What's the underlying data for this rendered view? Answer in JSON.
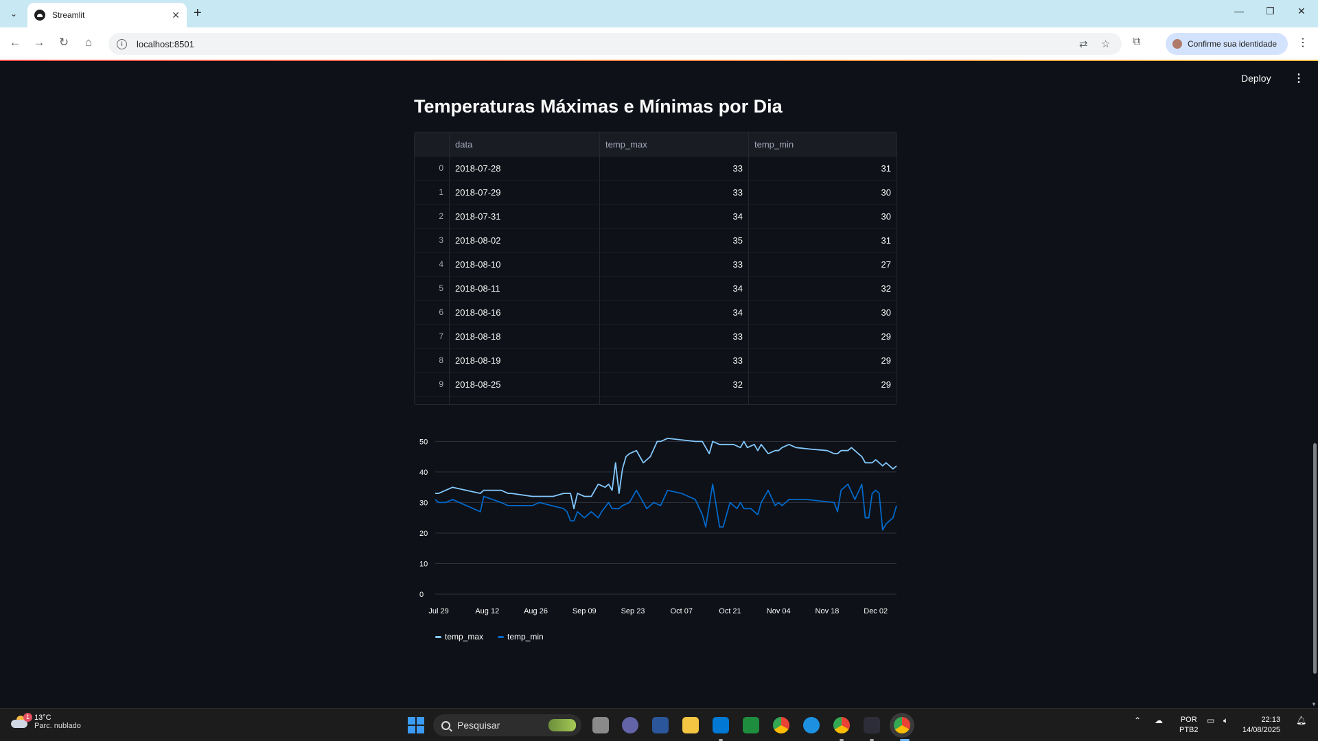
{
  "browser": {
    "tab_title": "Streamlit",
    "url": "localhost:8501",
    "profile_label": "Confirme sua identidade"
  },
  "app": {
    "deploy_label": "Deploy",
    "title": "Temperaturas Máximas e Mínimas por Dia"
  },
  "table": {
    "columns": [
      "data",
      "temp_max",
      "temp_min"
    ],
    "rows": [
      [
        "0",
        "2018-07-28",
        "33",
        "31"
      ],
      [
        "1",
        "2018-07-29",
        "33",
        "30"
      ],
      [
        "2",
        "2018-07-31",
        "34",
        "30"
      ],
      [
        "3",
        "2018-08-02",
        "35",
        "31"
      ],
      [
        "4",
        "2018-08-10",
        "33",
        "27"
      ],
      [
        "5",
        "2018-08-11",
        "34",
        "32"
      ],
      [
        "6",
        "2018-08-16",
        "34",
        "30"
      ],
      [
        "7",
        "2018-08-18",
        "33",
        "29"
      ],
      [
        "8",
        "2018-08-19",
        "33",
        "29"
      ],
      [
        "9",
        "2018-08-25",
        "32",
        "29"
      ]
    ]
  },
  "chart_data": {
    "type": "line",
    "title": "",
    "xlabel": "",
    "ylabel": "",
    "x_start": "2018-07-28",
    "x_end": "2018-12-08",
    "ylim": [
      0,
      53
    ],
    "y_ticks": [
      "0",
      "10",
      "20",
      "30",
      "40",
      "50"
    ],
    "x_ticks": [
      {
        "label": "Jul 29",
        "date": "2018-07-29"
      },
      {
        "label": "Aug 12",
        "date": "2018-08-12"
      },
      {
        "label": "Aug 26",
        "date": "2018-08-26"
      },
      {
        "label": "Sep 09",
        "date": "2018-09-09"
      },
      {
        "label": "Sep 23",
        "date": "2018-09-23"
      },
      {
        "label": "Oct 07",
        "date": "2018-10-07"
      },
      {
        "label": "Oct 21",
        "date": "2018-10-21"
      },
      {
        "label": "Nov 04",
        "date": "2018-11-04"
      },
      {
        "label": "Nov 18",
        "date": "2018-11-18"
      },
      {
        "label": "Dec 02",
        "date": "2018-12-02"
      }
    ],
    "grid": true,
    "legend": "bottom-left",
    "series": [
      {
        "name": "temp_max",
        "color": "#83c9ff",
        "points": [
          [
            "2018-07-28",
            33
          ],
          [
            "2018-07-29",
            33
          ],
          [
            "2018-07-31",
            34
          ],
          [
            "2018-08-02",
            35
          ],
          [
            "2018-08-10",
            33
          ],
          [
            "2018-08-11",
            34
          ],
          [
            "2018-08-16",
            34
          ],
          [
            "2018-08-18",
            33
          ],
          [
            "2018-08-19",
            33
          ],
          [
            "2018-08-25",
            32
          ],
          [
            "2018-08-31",
            32
          ],
          [
            "2018-09-03",
            33
          ],
          [
            "2018-09-05",
            33
          ],
          [
            "2018-09-06",
            28
          ],
          [
            "2018-09-07",
            33
          ],
          [
            "2018-09-09",
            32
          ],
          [
            "2018-09-11",
            32
          ],
          [
            "2018-09-13",
            36
          ],
          [
            "2018-09-15",
            35
          ],
          [
            "2018-09-16",
            36
          ],
          [
            "2018-09-17",
            34
          ],
          [
            "2018-09-18",
            43
          ],
          [
            "2018-09-19",
            33
          ],
          [
            "2018-09-20",
            41
          ],
          [
            "2018-09-21",
            45
          ],
          [
            "2018-09-22",
            46
          ],
          [
            "2018-09-24",
            47
          ],
          [
            "2018-09-26",
            43
          ],
          [
            "2018-09-28",
            45
          ],
          [
            "2018-09-30",
            50
          ],
          [
            "2018-10-01",
            50
          ],
          [
            "2018-10-03",
            51
          ],
          [
            "2018-10-07",
            50.5
          ],
          [
            "2018-10-11",
            50
          ],
          [
            "2018-10-13",
            50
          ],
          [
            "2018-10-15",
            46
          ],
          [
            "2018-10-16",
            50
          ],
          [
            "2018-10-18",
            49
          ],
          [
            "2018-10-20",
            49
          ],
          [
            "2018-10-22",
            49
          ],
          [
            "2018-10-24",
            48
          ],
          [
            "2018-10-25",
            50
          ],
          [
            "2018-10-26",
            48
          ],
          [
            "2018-10-28",
            49
          ],
          [
            "2018-10-29",
            47
          ],
          [
            "2018-10-30",
            49
          ],
          [
            "2018-11-01",
            46
          ],
          [
            "2018-11-03",
            47
          ],
          [
            "2018-11-04",
            47
          ],
          [
            "2018-11-05",
            48
          ],
          [
            "2018-11-07",
            49
          ],
          [
            "2018-11-09",
            48
          ],
          [
            "2018-11-13",
            47.5
          ],
          [
            "2018-11-18",
            47
          ],
          [
            "2018-11-20",
            46
          ],
          [
            "2018-11-21",
            46
          ],
          [
            "2018-11-22",
            47
          ],
          [
            "2018-11-24",
            47
          ],
          [
            "2018-11-25",
            48
          ],
          [
            "2018-11-27",
            46
          ],
          [
            "2018-11-28",
            45
          ],
          [
            "2018-11-29",
            43
          ],
          [
            "2018-12-01",
            43
          ],
          [
            "2018-12-02",
            44
          ],
          [
            "2018-12-03",
            43
          ],
          [
            "2018-12-04",
            42
          ],
          [
            "2018-12-05",
            43
          ],
          [
            "2018-12-06",
            42
          ],
          [
            "2018-12-07",
            41
          ],
          [
            "2018-12-08",
            42
          ]
        ]
      },
      {
        "name": "temp_min",
        "color": "#0068c9",
        "points": [
          [
            "2018-07-28",
            31
          ],
          [
            "2018-07-29",
            30
          ],
          [
            "2018-07-31",
            30
          ],
          [
            "2018-08-02",
            31
          ],
          [
            "2018-08-10",
            27
          ],
          [
            "2018-08-11",
            32
          ],
          [
            "2018-08-16",
            30
          ],
          [
            "2018-08-18",
            29
          ],
          [
            "2018-08-19",
            29
          ],
          [
            "2018-08-25",
            29
          ],
          [
            "2018-08-27",
            30
          ],
          [
            "2018-09-03",
            28
          ],
          [
            "2018-09-04",
            27
          ],
          [
            "2018-09-05",
            24
          ],
          [
            "2018-09-06",
            24
          ],
          [
            "2018-09-07",
            27
          ],
          [
            "2018-09-09",
            25
          ],
          [
            "2018-09-11",
            27
          ],
          [
            "2018-09-12",
            26
          ],
          [
            "2018-09-13",
            25
          ],
          [
            "2018-09-14",
            27
          ],
          [
            "2018-09-16",
            30
          ],
          [
            "2018-09-17",
            28
          ],
          [
            "2018-09-19",
            28
          ],
          [
            "2018-09-20",
            29
          ],
          [
            "2018-09-22",
            30
          ],
          [
            "2018-09-24",
            34
          ],
          [
            "2018-09-26",
            30
          ],
          [
            "2018-09-27",
            28
          ],
          [
            "2018-09-29",
            30
          ],
          [
            "2018-10-01",
            29
          ],
          [
            "2018-10-03",
            34
          ],
          [
            "2018-10-07",
            33
          ],
          [
            "2018-10-11",
            31
          ],
          [
            "2018-10-13",
            26
          ],
          [
            "2018-10-14",
            22
          ],
          [
            "2018-10-16",
            36
          ],
          [
            "2018-10-18",
            22
          ],
          [
            "2018-10-19",
            22
          ],
          [
            "2018-10-21",
            30
          ],
          [
            "2018-10-23",
            28
          ],
          [
            "2018-10-24",
            30
          ],
          [
            "2018-10-25",
            28
          ],
          [
            "2018-10-27",
            28
          ],
          [
            "2018-10-29",
            26
          ],
          [
            "2018-10-30",
            30
          ],
          [
            "2018-11-01",
            34
          ],
          [
            "2018-11-03",
            29
          ],
          [
            "2018-11-04",
            30
          ],
          [
            "2018-11-05",
            29
          ],
          [
            "2018-11-07",
            31
          ],
          [
            "2018-11-12",
            31
          ],
          [
            "2018-11-20",
            30
          ],
          [
            "2018-11-21",
            27
          ],
          [
            "2018-11-22",
            34
          ],
          [
            "2018-11-24",
            36
          ],
          [
            "2018-11-26",
            31
          ],
          [
            "2018-11-28",
            36
          ],
          [
            "2018-11-29",
            25
          ],
          [
            "2018-11-30",
            25
          ],
          [
            "2018-12-01",
            33
          ],
          [
            "2018-12-02",
            34
          ],
          [
            "2018-12-03",
            33
          ],
          [
            "2018-12-04",
            21
          ],
          [
            "2018-12-05",
            23
          ],
          [
            "2018-12-06",
            24
          ],
          [
            "2018-12-07",
            25
          ],
          [
            "2018-12-08",
            29
          ]
        ]
      }
    ]
  },
  "taskbar": {
    "weather_temp": "13°C",
    "weather_desc": "Parc. nublado",
    "weather_badge": "1",
    "search_placeholder": "Pesquisar",
    "lang_line1": "POR",
    "lang_line2": "PTB2",
    "time": "22:13",
    "date": "14/08/2025"
  }
}
